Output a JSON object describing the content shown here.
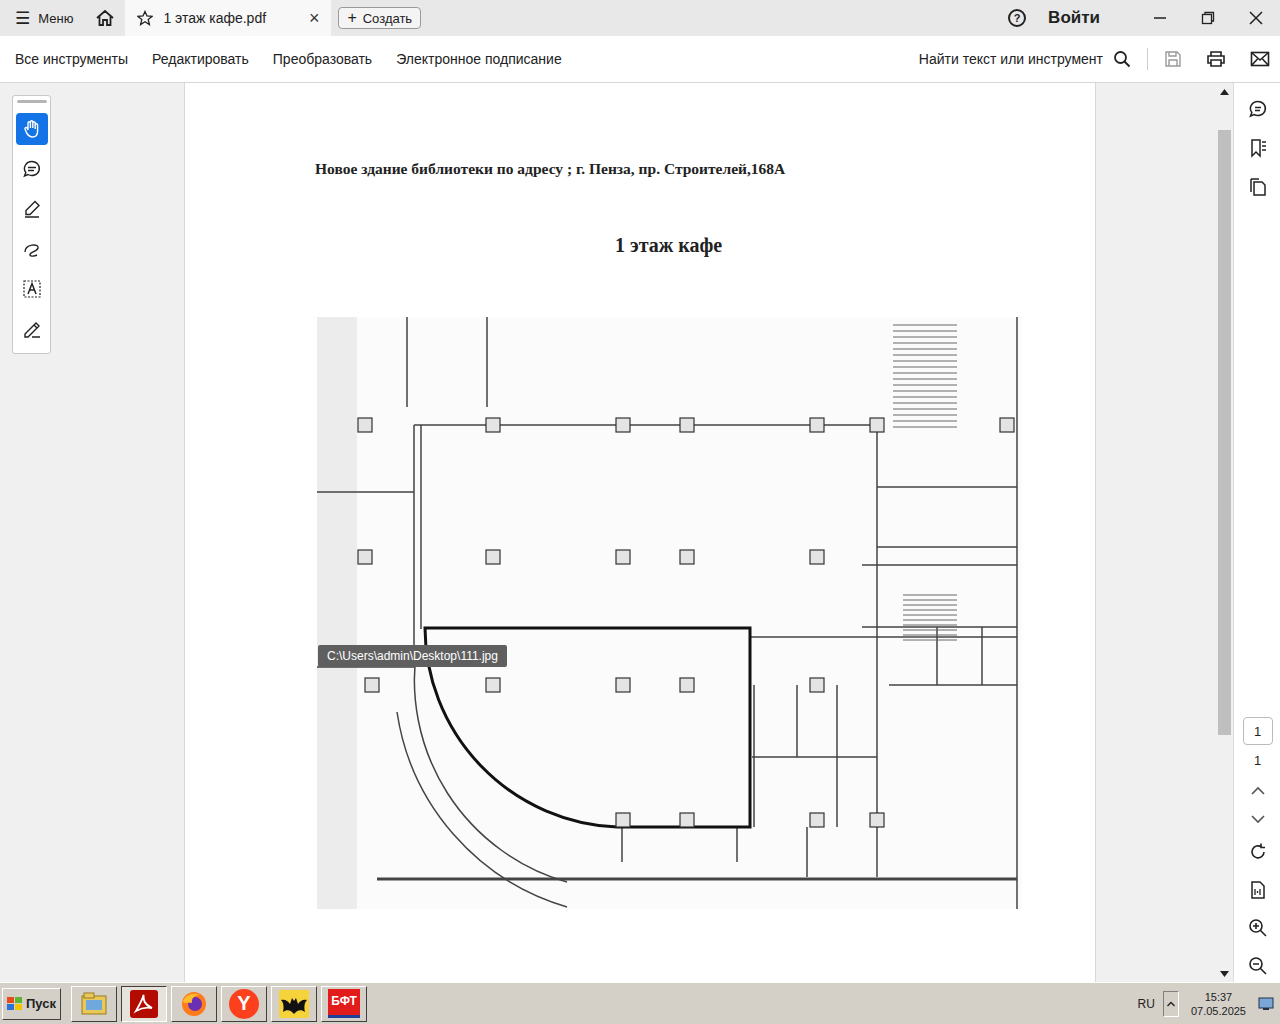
{
  "window": {
    "menu_icon": "☰",
    "menu": "Меню",
    "tab": {
      "label": "1 этаж кафе.pdf",
      "selected": true,
      "close": "×"
    },
    "create": {
      "icon": "+",
      "label": "Создать"
    },
    "help": "?",
    "signin": "Войти"
  },
  "toolbar": {
    "items": [
      "Все инструменты",
      "Редактировать",
      "Преобразовать",
      "Электронное подписание"
    ],
    "search": "Найти текст или инструмент"
  },
  "tools": [
    {
      "kind": "hand",
      "selected": true
    },
    {
      "kind": "comment",
      "selected": false
    },
    {
      "kind": "highlight",
      "selected": false
    },
    {
      "kind": "draw",
      "selected": false
    },
    {
      "kind": "text",
      "selected": false
    },
    {
      "kind": "sign",
      "selected": false
    }
  ],
  "document": {
    "heading": "Новое здание библиотеки по адресу ; г. Пенза, пр. Строителей,168А",
    "title": "1 этаж кафе"
  },
  "tooltip": "C:\\Users\\admin\\Desktop\\111.jpg",
  "page_nav": {
    "current": "1",
    "total": "1"
  },
  "taskbar": {
    "start": "Пуск",
    "apps": [
      {
        "kind": "files",
        "label": "",
        "selected": false
      },
      {
        "kind": "acrobat",
        "label": "",
        "selected": true
      },
      {
        "kind": "firefox",
        "label": "",
        "selected": false
      },
      {
        "kind": "yandex",
        "label": "Y",
        "selected": false
      },
      {
        "kind": "bat",
        "label": "",
        "selected": false
      },
      {
        "kind": "bft",
        "label": "БФТ",
        "selected": false
      }
    ],
    "lang": "RU",
    "time": "15:37",
    "date": "07.05.2025"
  }
}
